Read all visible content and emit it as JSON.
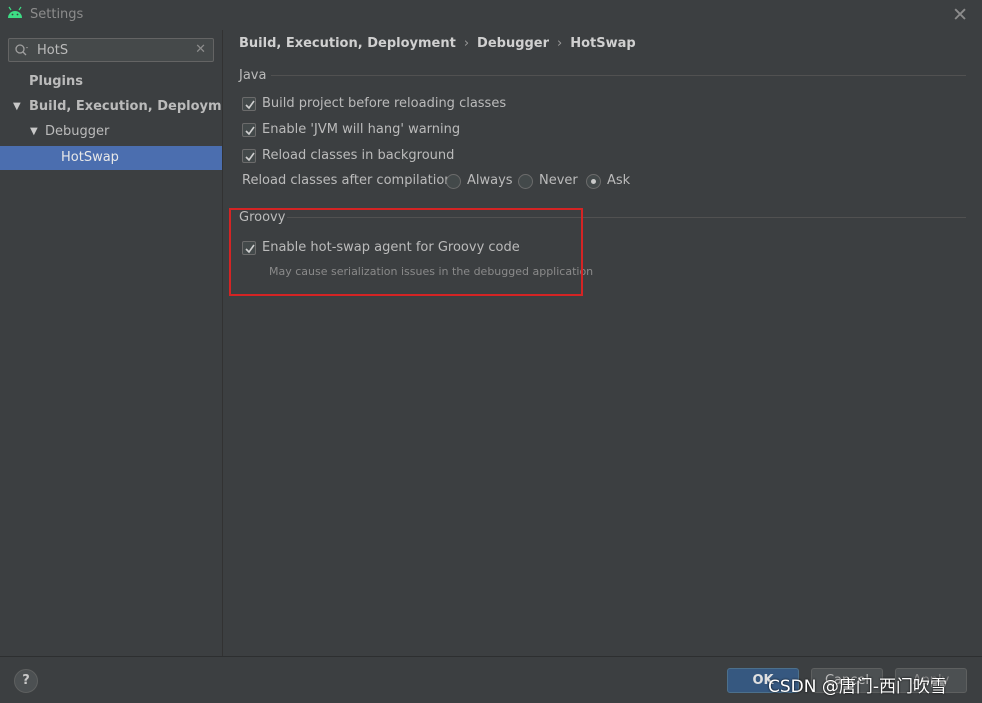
{
  "window": {
    "title": "Settings",
    "close_glyph": "✕"
  },
  "search": {
    "value": "HotS",
    "clear_glyph": "✕"
  },
  "sidebar": {
    "items": [
      {
        "label": "Plugins"
      },
      {
        "label": "Build, Execution, Deployment",
        "expanded": true
      },
      {
        "label": "Debugger",
        "expanded": true
      },
      {
        "label": "HotSwap",
        "selected": true
      }
    ]
  },
  "breadcrumb": {
    "items": [
      "Build, Execution, Deployment",
      "Debugger",
      "HotSwap"
    ],
    "separator": "›"
  },
  "java_group": {
    "title": "Java",
    "checkboxes": [
      {
        "label": "Build project before reloading classes",
        "checked": true
      },
      {
        "label": "Enable 'JVM will hang' warning",
        "checked": true
      },
      {
        "label": "Reload classes in background",
        "checked": true
      }
    ],
    "reload_label": "Reload classes after compilation:",
    "radio_options": [
      {
        "label": "Always",
        "selected": false
      },
      {
        "label": "Never",
        "selected": false
      },
      {
        "label": "Ask",
        "selected": true
      }
    ]
  },
  "groovy_group": {
    "title": "Groovy",
    "checkbox": {
      "label": "Enable hot-swap agent for Groovy code",
      "checked": true
    },
    "hint": "May cause serialization issues in the debugged application"
  },
  "footer": {
    "help_label": "?",
    "ok_label": "OK",
    "cancel_label": "Cancel",
    "apply_label": "Apply"
  },
  "watermark": "CSDN @唐门-西门吹雪",
  "colors": {
    "background": "#3c3f41",
    "selection": "#4b6eaf",
    "highlight_border": "#d42424",
    "android_green": "#3ddc84"
  }
}
